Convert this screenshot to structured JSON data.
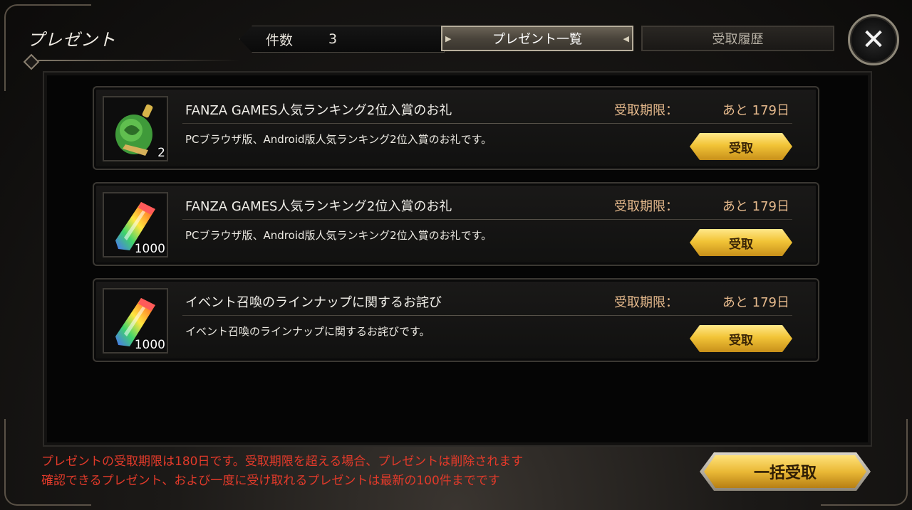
{
  "header": {
    "title": "プレゼント",
    "count_label": "件数",
    "count_value": "3",
    "tabs": [
      {
        "label": "プレゼント一覧",
        "active": true
      },
      {
        "label": "受取履歴",
        "active": false
      }
    ],
    "close_icon": "close-icon"
  },
  "presents": [
    {
      "icon": "green-bag-icon",
      "quantity": "2",
      "title": "FANZA GAMES人気ランキング2位入賞のお礼",
      "description": "PCブラウザ版、Android版人気ランキング2位入賞のお礼です。",
      "deadline_label": "受取期限：",
      "deadline_value": "あと 179日",
      "button_label": "受取"
    },
    {
      "icon": "rainbow-crystal-icon",
      "quantity": "1000",
      "title": "FANZA GAMES人気ランキング2位入賞のお礼",
      "description": "PCブラウザ版、Android版人気ランキング2位入賞のお礼です。",
      "deadline_label": "受取期限：",
      "deadline_value": "あと 179日",
      "button_label": "受取"
    },
    {
      "icon": "rainbow-crystal-icon",
      "quantity": "1000",
      "title": "イベント召喚のラインナップに関するお詫び",
      "description": "イベント召喚のラインナップに関するお詫びです。",
      "deadline_label": "受取期限：",
      "deadline_value": "あと 179日",
      "button_label": "受取"
    }
  ],
  "footer": {
    "notice_line1": "プレゼントの受取期限は180日です。受取期限を超える場合、プレゼントは削除されます",
    "notice_line2": "確認できるプレゼント、および一度に受け取れるプレゼントは最新の100件までです",
    "bulk_button_label": "一括受取"
  },
  "colors": {
    "notice": "#e23a2a",
    "deadline": "#e5b98c",
    "gold_button": "#f2c437"
  }
}
